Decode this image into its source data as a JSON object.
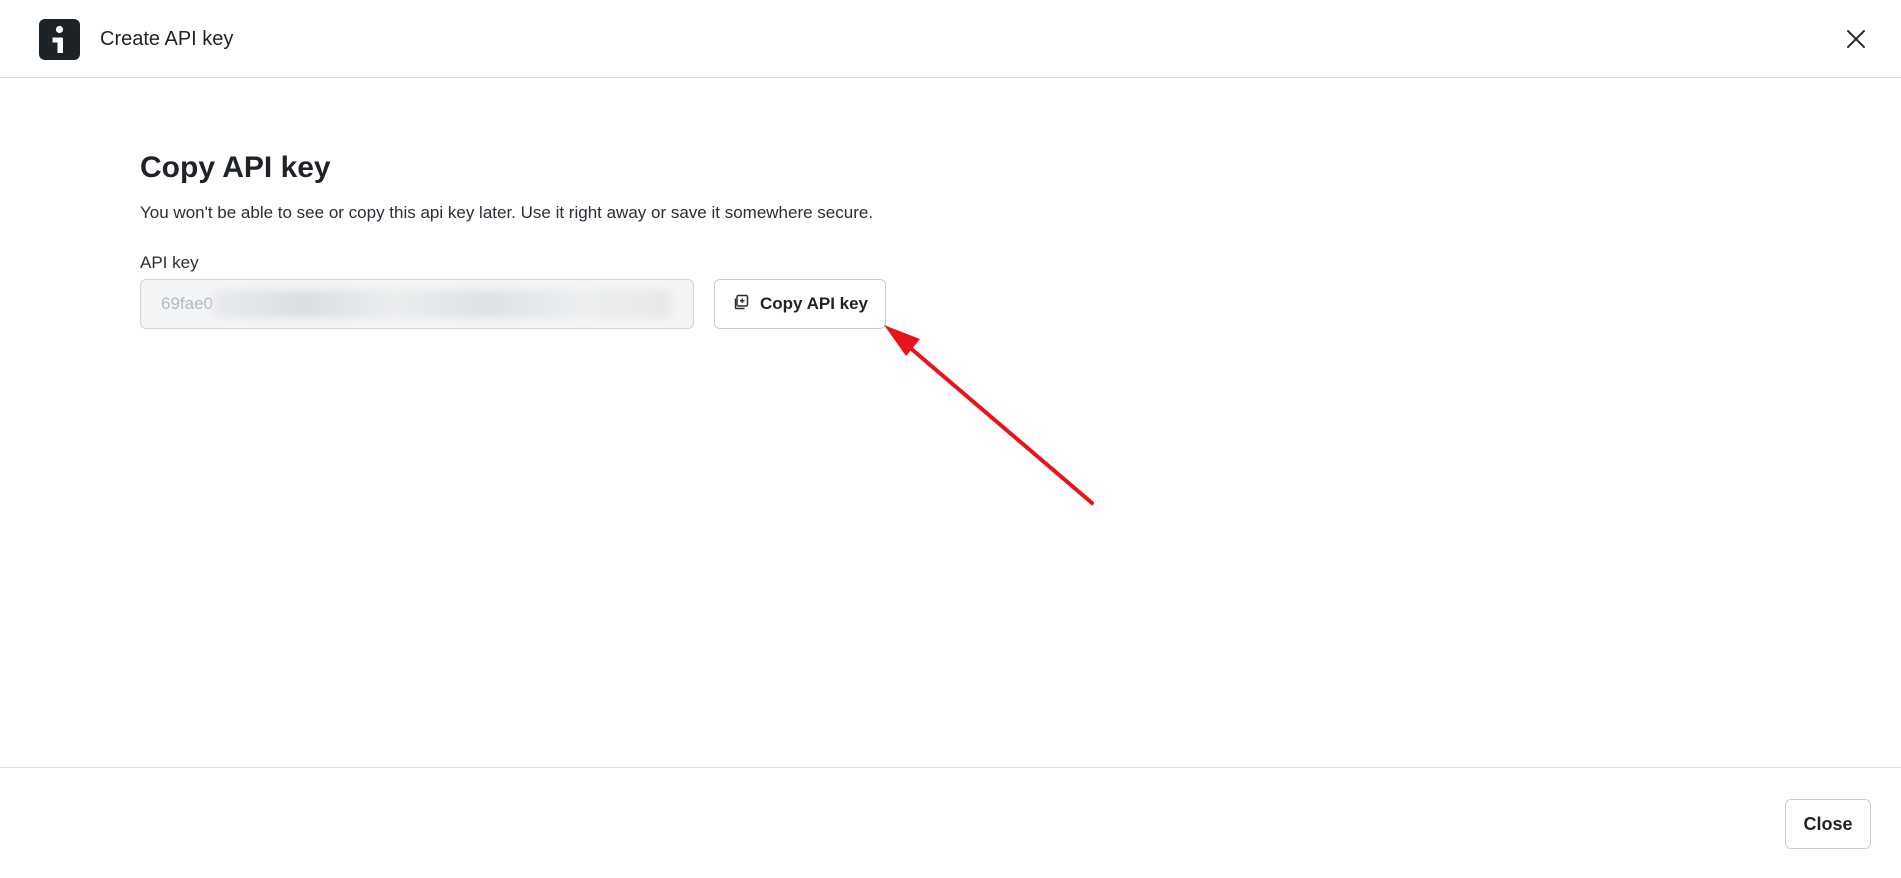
{
  "header": {
    "title": "Create API key",
    "logo_icon": "info-logo-icon",
    "close_icon": "close-icon"
  },
  "main": {
    "title": "Copy API key",
    "description": "You won't be able to see or copy this api key later. Use it right away or save it somewhere secure.",
    "field_label": "API key",
    "api_key_visible_prefix": "69fae0",
    "copy_button_label": "Copy API key",
    "copy_icon": "copy-icon"
  },
  "annotation": {
    "arrow_color": "#e8141b"
  },
  "footer": {
    "close_label": "Close"
  }
}
